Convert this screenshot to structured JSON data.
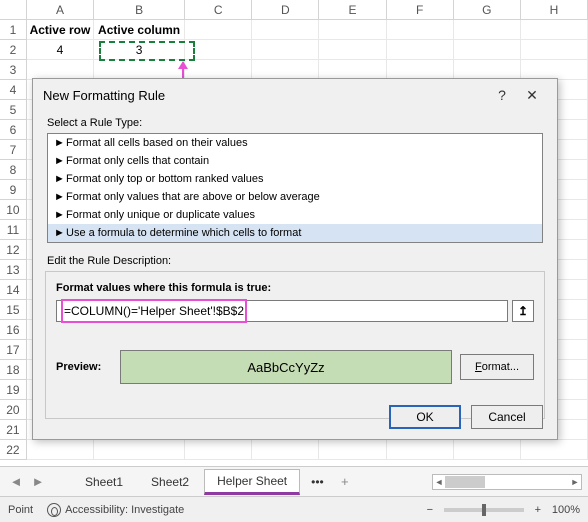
{
  "columns": [
    "A",
    "B",
    "C",
    "D",
    "E",
    "F",
    "G",
    "H"
  ],
  "rows": [
    "1",
    "2",
    "3",
    "4",
    "5",
    "6",
    "7",
    "8",
    "9",
    "10",
    "11",
    "12",
    "13",
    "14",
    "15",
    "16",
    "17",
    "18",
    "19",
    "20",
    "21",
    "22"
  ],
  "headers": {
    "a1": "Active row",
    "b1": "Active column"
  },
  "values": {
    "a2": "4",
    "b2": "3"
  },
  "dialog": {
    "title": "New Formatting Rule",
    "help": "?",
    "close": "✕",
    "selectLabel": "Select a Rule Type:",
    "rules": [
      "Format all cells based on their values",
      "Format only cells that contain",
      "Format only top or bottom ranked values",
      "Format only values that are above or below average",
      "Format only unique or duplicate values",
      "Use a formula to determine which cells to format"
    ],
    "editLabel": "Edit the Rule Description:",
    "formulaLabel": "Format values where this formula is true:",
    "formula": "=COLUMN()='Helper Sheet'!$B$2",
    "previewLabel": "Preview:",
    "previewText": "AaBbCcYyZz",
    "formatBtn": "Format...",
    "ok": "OK",
    "cancel": "Cancel",
    "refIcon": "↥"
  },
  "tabs": {
    "s1": "Sheet1",
    "s2": "Sheet2",
    "helper": "Helper Sheet",
    "more": "•••",
    "add": "+"
  },
  "status": {
    "mode": "Point",
    "acc": "Accessibility: Investigate",
    "zoom": "100%",
    "minus": "−",
    "plus": "+"
  }
}
